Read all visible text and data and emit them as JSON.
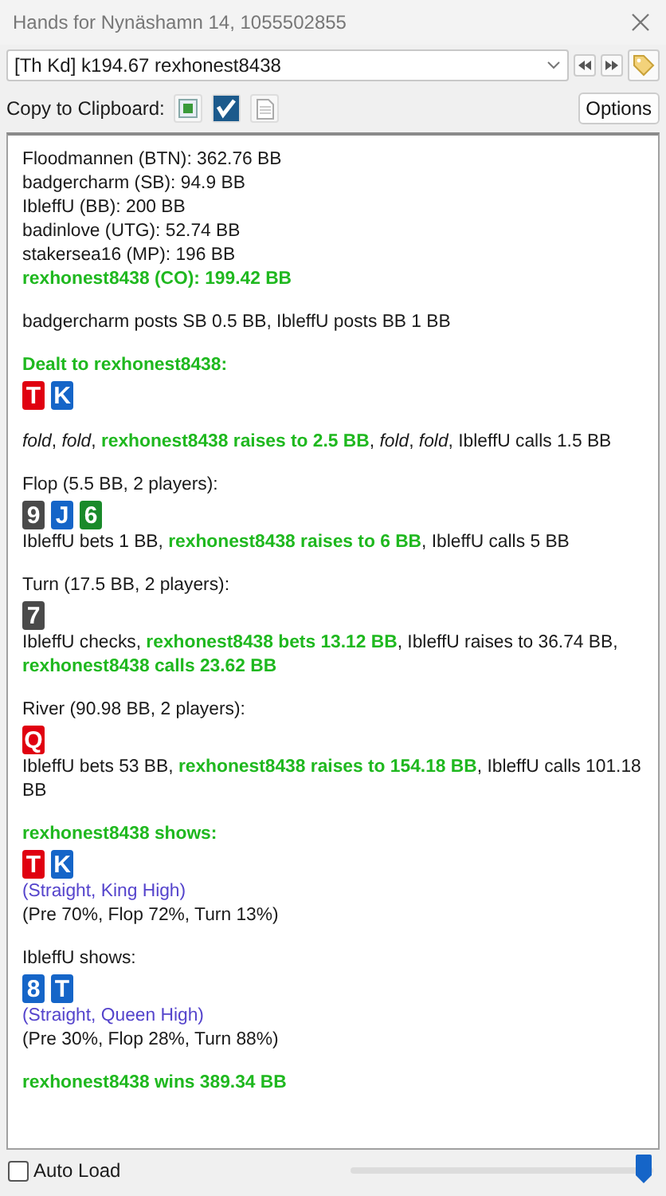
{
  "window": {
    "title": "Hands for Nynäshamn 14, 1055502855"
  },
  "hand_selector": {
    "value": "[Th Kd] k194.67 rexhonest8438"
  },
  "copy_toolbar": {
    "label": "Copy to Clipboard:",
    "options_button": "Options"
  },
  "history": {
    "sections": [
      {
        "rows": [
          {
            "kind": "text",
            "segments": [
              {
                "text": "Floodmannen (BTN): 362.76 BB",
                "kind": "plain"
              }
            ]
          },
          {
            "kind": "text",
            "segments": [
              {
                "text": "badgercharm (SB): 94.9 BB",
                "kind": "plain"
              }
            ]
          },
          {
            "kind": "text",
            "segments": [
              {
                "text": "IbleffU (BB): 200 BB",
                "kind": "plain"
              }
            ]
          },
          {
            "kind": "text",
            "segments": [
              {
                "text": "badinlove (UTG): 52.74 BB",
                "kind": "plain"
              }
            ]
          },
          {
            "kind": "text",
            "segments": [
              {
                "text": "stakersea16 (MP): 196 BB",
                "kind": "plain"
              }
            ]
          },
          {
            "kind": "text",
            "segments": [
              {
                "text": "rexhonest8438 (CO): 199.42 BB",
                "kind": "hero"
              }
            ]
          }
        ]
      },
      {
        "rows": [
          {
            "kind": "text",
            "segments": [
              {
                "text": "badgercharm posts SB 0.5 BB, IbleffU posts BB 1 BB",
                "kind": "plain"
              }
            ]
          }
        ]
      },
      {
        "rows": [
          {
            "kind": "text",
            "segments": [
              {
                "text": "Dealt to rexhonest8438:",
                "kind": "hero"
              }
            ]
          },
          {
            "kind": "cards",
            "cards": [
              {
                "rank": "T",
                "color": "#e00010"
              },
              {
                "rank": "K",
                "color": "#1565c8"
              }
            ]
          }
        ]
      },
      {
        "rows": [
          {
            "kind": "text",
            "segments": [
              {
                "text": "*fold*, *fold*, ",
                "kind": "plain"
              },
              {
                "text": "rexhonest8438 raises to 2.5 BB",
                "kind": "hero"
              },
              {
                "text": ", *fold*, *fold*, IbleffU calls 1.5 BB",
                "kind": "plain"
              }
            ]
          }
        ]
      },
      {
        "rows": [
          {
            "kind": "text",
            "segments": [
              {
                "text": "Flop (5.5 BB, 2 players):",
                "kind": "plain"
              }
            ]
          },
          {
            "kind": "cards",
            "cards": [
              {
                "rank": "9",
                "color": "#4a4a4a"
              },
              {
                "rank": "J",
                "color": "#1565c8"
              },
              {
                "rank": "6",
                "color": "#1a8a2a"
              }
            ]
          },
          {
            "kind": "text",
            "segments": [
              {
                "text": "IbleffU bets 1 BB, ",
                "kind": "plain"
              },
              {
                "text": "rexhonest8438 raises to 6 BB",
                "kind": "hero"
              },
              {
                "text": ", IbleffU calls 5 BB",
                "kind": "plain"
              }
            ]
          }
        ]
      },
      {
        "rows": [
          {
            "kind": "text",
            "segments": [
              {
                "text": "Turn (17.5 BB, 2 players):",
                "kind": "plain"
              }
            ]
          },
          {
            "kind": "cards",
            "cards": [
              {
                "rank": "7",
                "color": "#4a4a4a"
              }
            ]
          },
          {
            "kind": "text",
            "segments": [
              {
                "text": "IbleffU checks, ",
                "kind": "plain"
              },
              {
                "text": "rexhonest8438 bets 13.12 BB",
                "kind": "hero"
              },
              {
                "text": ", IbleffU raises to 36.74 BB, ",
                "kind": "plain"
              },
              {
                "text": "rexhonest8438 calls 23.62 BB",
                "kind": "hero"
              }
            ]
          }
        ]
      },
      {
        "rows": [
          {
            "kind": "text",
            "segments": [
              {
                "text": "River (90.98 BB, 2 players):",
                "kind": "plain"
              }
            ]
          },
          {
            "kind": "cards",
            "cards": [
              {
                "rank": "Q",
                "color": "#e00010"
              }
            ]
          },
          {
            "kind": "text",
            "segments": [
              {
                "text": "IbleffU bets 53 BB, ",
                "kind": "plain"
              },
              {
                "text": "rexhonest8438 raises to 154.18 BB",
                "kind": "hero"
              },
              {
                "text": ", IbleffU calls 101.18 BB",
                "kind": "plain"
              }
            ]
          }
        ]
      },
      {
        "rows": [
          {
            "kind": "text",
            "segments": [
              {
                "text": "rexhonest8438 shows:",
                "kind": "hero"
              }
            ]
          },
          {
            "kind": "cards",
            "cards": [
              {
                "rank": "T",
                "color": "#e00010"
              },
              {
                "rank": "K",
                "color": "#1565c8"
              }
            ]
          },
          {
            "kind": "text",
            "segments": [
              {
                "text": "(Straight, King High)",
                "kind": "hand"
              }
            ]
          },
          {
            "kind": "text",
            "segments": [
              {
                "text": "(Pre 70%, Flop 72%, Turn 13%)",
                "kind": "plain"
              }
            ]
          }
        ]
      },
      {
        "rows": [
          {
            "kind": "text",
            "segments": [
              {
                "text": "IbleffU shows:",
                "kind": "plain"
              }
            ]
          },
          {
            "kind": "cards",
            "cards": [
              {
                "rank": "8",
                "color": "#1565c8"
              },
              {
                "rank": "T",
                "color": "#1565c8"
              }
            ]
          },
          {
            "kind": "text",
            "segments": [
              {
                "text": "(Straight, Queen High)",
                "kind": "hand"
              }
            ]
          },
          {
            "kind": "text",
            "segments": [
              {
                "text": "(Pre 30%, Flop 28%, Turn 88%)",
                "kind": "plain"
              }
            ]
          }
        ]
      },
      {
        "rows": [
          {
            "kind": "text",
            "segments": [
              {
                "text": "rexhonest8438 wins 389.34 BB",
                "kind": "hero"
              }
            ]
          }
        ]
      }
    ]
  },
  "footer": {
    "auto_load": {
      "label": "Auto Load",
      "checked": false
    },
    "slider": {
      "level": 0.97
    }
  }
}
